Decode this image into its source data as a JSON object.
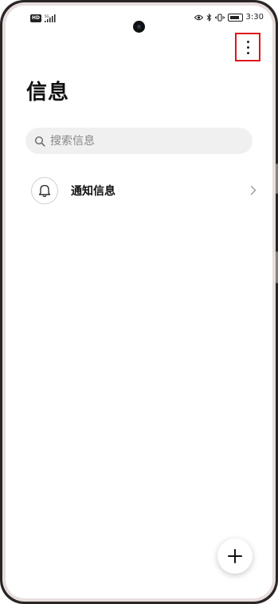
{
  "status_bar": {
    "network_badge": "HD",
    "signal_label": "5G",
    "time": "3:30"
  },
  "header": {
    "title": "信息",
    "more_icon": "more-vertical-icon"
  },
  "search": {
    "placeholder": "搜索信息",
    "icon": "search-icon"
  },
  "list": {
    "items": [
      {
        "label": "通知信息",
        "icon": "bell-icon",
        "trailing_icon": "chevron-right-icon"
      }
    ]
  },
  "fab": {
    "icon": "plus-icon"
  },
  "colors": {
    "highlight_box": "#e01616",
    "search_bg": "#f0f0f0"
  }
}
